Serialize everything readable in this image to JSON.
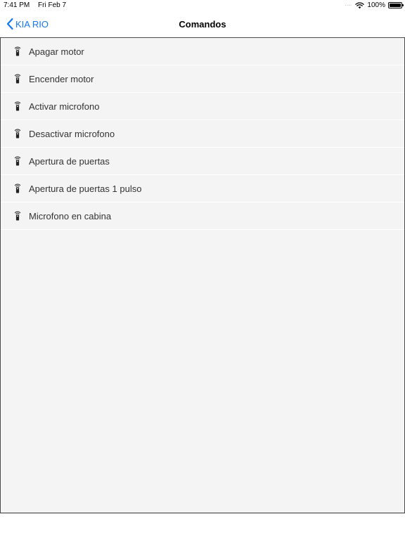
{
  "status_bar": {
    "time": "7:41 PM",
    "date": "Fri Feb 7",
    "signal": "....",
    "battery": "100%",
    "battery_level": 1.0
  },
  "nav": {
    "back_label": "KIA RIO",
    "title": "Comandos"
  },
  "commands": [
    {
      "label": "Apagar motor",
      "icon": "remote-control-icon"
    },
    {
      "label": "Encender motor",
      "icon": "remote-control-icon"
    },
    {
      "label": "Activar microfono",
      "icon": "remote-control-icon"
    },
    {
      "label": "Desactivar microfono",
      "icon": "remote-control-icon"
    },
    {
      "label": "Apertura de puertas",
      "icon": "remote-control-icon"
    },
    {
      "label": "Apertura de puertas 1 pulso",
      "icon": "remote-control-icon"
    },
    {
      "label": "Microfono en cabina",
      "icon": "remote-control-icon"
    }
  ],
  "colors": {
    "accent": "#1478f0",
    "list_background": "#f4f4f4"
  }
}
